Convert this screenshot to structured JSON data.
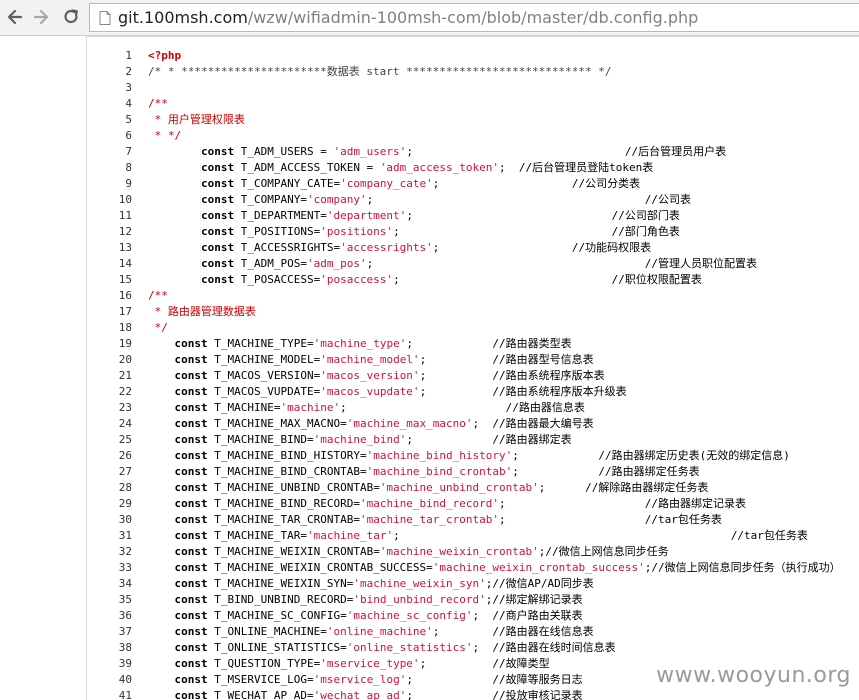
{
  "browser": {
    "url_host": "git.100msh.com",
    "url_path": "/wzw/wifiadmin-100msh-com/blob/master/db.config.php",
    "back_icon": "back-arrow-icon",
    "forward_icon": "forward-arrow-icon",
    "reload_icon": "reload-icon",
    "page_icon": "page-icon"
  },
  "code": {
    "lines": [
      {
        "n": "1",
        "segs": [
          {
            "t": "<?php",
            "k": "php"
          }
        ]
      },
      {
        "n": "2",
        "segs": [
          {
            "t": "/* * **********************数据表 start **************************** */",
            "k": "cm"
          }
        ]
      },
      {
        "n": "3",
        "segs": []
      },
      {
        "n": "4",
        "segs": [
          {
            "t": "/**",
            "k": "block"
          }
        ]
      },
      {
        "n": "5",
        "segs": [
          {
            "t": " * 用户管理权限表",
            "k": "block"
          }
        ]
      },
      {
        "n": "6",
        "segs": [
          {
            "t": " * */",
            "k": "block"
          }
        ]
      },
      {
        "n": "7",
        "segs": [
          {
            "t": "        ",
            "k": "plain"
          },
          {
            "t": "const",
            "k": "kw"
          },
          {
            "t": " T_ADM_USERS = ",
            "k": "plain"
          },
          {
            "t": "'adm_users'",
            "k": "str"
          },
          {
            "t": ";                                //后台管理员用户表",
            "k": "plain"
          }
        ]
      },
      {
        "n": "8",
        "segs": [
          {
            "t": "        ",
            "k": "plain"
          },
          {
            "t": "const",
            "k": "kw"
          },
          {
            "t": " T_ADM_ACCESS_TOKEN = ",
            "k": "plain"
          },
          {
            "t": "'adm_access_token'",
            "k": "str"
          },
          {
            "t": ";  //后台管理员登陆token表",
            "k": "plain"
          }
        ]
      },
      {
        "n": "9",
        "segs": [
          {
            "t": "        ",
            "k": "plain"
          },
          {
            "t": "const",
            "k": "kw"
          },
          {
            "t": " T_COMPANY_CATE=",
            "k": "plain"
          },
          {
            "t": "'company_cate'",
            "k": "str"
          },
          {
            "t": ";                    //公司分类表",
            "k": "plain"
          }
        ]
      },
      {
        "n": "10",
        "segs": [
          {
            "t": "        ",
            "k": "plain"
          },
          {
            "t": "const",
            "k": "kw"
          },
          {
            "t": " T_COMPANY=",
            "k": "plain"
          },
          {
            "t": "'company'",
            "k": "str"
          },
          {
            "t": ";                                         //公司表",
            "k": "plain"
          }
        ]
      },
      {
        "n": "11",
        "segs": [
          {
            "t": "        ",
            "k": "plain"
          },
          {
            "t": "const",
            "k": "kw"
          },
          {
            "t": " T_DEPARTMENT=",
            "k": "plain"
          },
          {
            "t": "'department'",
            "k": "str"
          },
          {
            "t": ";                              //公司部门表",
            "k": "plain"
          }
        ]
      },
      {
        "n": "12",
        "segs": [
          {
            "t": "        ",
            "k": "plain"
          },
          {
            "t": "const",
            "k": "kw"
          },
          {
            "t": " T_POSITIONS=",
            "k": "plain"
          },
          {
            "t": "'positions'",
            "k": "str"
          },
          {
            "t": ";                                //部门角色表",
            "k": "plain"
          }
        ]
      },
      {
        "n": "13",
        "segs": [
          {
            "t": "        ",
            "k": "plain"
          },
          {
            "t": "const",
            "k": "kw"
          },
          {
            "t": " T_ACCESSRIGHTS=",
            "k": "plain"
          },
          {
            "t": "'accessrights'",
            "k": "str"
          },
          {
            "t": ";                    //功能码权限表",
            "k": "plain"
          }
        ]
      },
      {
        "n": "14",
        "segs": [
          {
            "t": "        ",
            "k": "plain"
          },
          {
            "t": "const",
            "k": "kw"
          },
          {
            "t": " T_ADM_POS=",
            "k": "plain"
          },
          {
            "t": "'adm_pos'",
            "k": "str"
          },
          {
            "t": ";                                         //管理人员职位配置表",
            "k": "plain"
          }
        ]
      },
      {
        "n": "15",
        "segs": [
          {
            "t": "        ",
            "k": "plain"
          },
          {
            "t": "const",
            "k": "kw"
          },
          {
            "t": " T_POSACCESS=",
            "k": "plain"
          },
          {
            "t": "'posaccess'",
            "k": "str"
          },
          {
            "t": ";                                //职位权限配置表",
            "k": "plain"
          }
        ]
      },
      {
        "n": "16",
        "segs": [
          {
            "t": "/**",
            "k": "block"
          }
        ]
      },
      {
        "n": "17",
        "segs": [
          {
            "t": " * 路由器管理数据表",
            "k": "block"
          }
        ]
      },
      {
        "n": "18",
        "segs": [
          {
            "t": " */",
            "k": "block"
          }
        ]
      },
      {
        "n": "19",
        "segs": [
          {
            "t": "    ",
            "k": "plain"
          },
          {
            "t": "const",
            "k": "kw"
          },
          {
            "t": " T_MACHINE_TYPE=",
            "k": "plain"
          },
          {
            "t": "'machine_type'",
            "k": "str"
          },
          {
            "t": ";            //路由器类型表",
            "k": "plain"
          }
        ]
      },
      {
        "n": "20",
        "segs": [
          {
            "t": "    ",
            "k": "plain"
          },
          {
            "t": "const",
            "k": "kw"
          },
          {
            "t": " T_MACHINE_MODEL=",
            "k": "plain"
          },
          {
            "t": "'machine_model'",
            "k": "str"
          },
          {
            "t": ";          //路由器型号信息表",
            "k": "plain"
          }
        ]
      },
      {
        "n": "21",
        "segs": [
          {
            "t": "    ",
            "k": "plain"
          },
          {
            "t": "const",
            "k": "kw"
          },
          {
            "t": " T_MACOS_VERSION=",
            "k": "plain"
          },
          {
            "t": "'macos_version'",
            "k": "str"
          },
          {
            "t": ";          //路由系统程序版本表",
            "k": "plain"
          }
        ]
      },
      {
        "n": "22",
        "segs": [
          {
            "t": "    ",
            "k": "plain"
          },
          {
            "t": "const",
            "k": "kw"
          },
          {
            "t": " T_MACOS_VUPDATE=",
            "k": "plain"
          },
          {
            "t": "'macos_vupdate'",
            "k": "str"
          },
          {
            "t": ";          //路由系统程序版本升级表",
            "k": "plain"
          }
        ]
      },
      {
        "n": "23",
        "segs": [
          {
            "t": "    ",
            "k": "plain"
          },
          {
            "t": "const",
            "k": "kw"
          },
          {
            "t": " T_MACHINE=",
            "k": "plain"
          },
          {
            "t": "'machine'",
            "k": "str"
          },
          {
            "t": ";                        //路由器信息表",
            "k": "plain"
          }
        ]
      },
      {
        "n": "24",
        "segs": [
          {
            "t": "    ",
            "k": "plain"
          },
          {
            "t": "const",
            "k": "kw"
          },
          {
            "t": " T_MACHINE_MAX_MACNO=",
            "k": "plain"
          },
          {
            "t": "'machine_max_macno'",
            "k": "str"
          },
          {
            "t": ";  //路由器最大编号表",
            "k": "plain"
          }
        ]
      },
      {
        "n": "25",
        "segs": [
          {
            "t": "    ",
            "k": "plain"
          },
          {
            "t": "const",
            "k": "kw"
          },
          {
            "t": " T_MACHINE_BIND=",
            "k": "plain"
          },
          {
            "t": "'machine_bind'",
            "k": "str"
          },
          {
            "t": ";            //路由器绑定表",
            "k": "plain"
          }
        ]
      },
      {
        "n": "26",
        "segs": [
          {
            "t": "    ",
            "k": "plain"
          },
          {
            "t": "const",
            "k": "kw"
          },
          {
            "t": " T_MACHINE_BIND_HISTORY=",
            "k": "plain"
          },
          {
            "t": "'machine_bind_history'",
            "k": "str"
          },
          {
            "t": ";            //路由器绑定历史表(无效的绑定信息)",
            "k": "plain"
          }
        ]
      },
      {
        "n": "27",
        "segs": [
          {
            "t": "    ",
            "k": "plain"
          },
          {
            "t": "const",
            "k": "kw"
          },
          {
            "t": " T_MACHINE_BIND_CRONTAB=",
            "k": "plain"
          },
          {
            "t": "'machine_bind_crontab'",
            "k": "str"
          },
          {
            "t": ";            //路由器绑定任务表",
            "k": "plain"
          }
        ]
      },
      {
        "n": "28",
        "segs": [
          {
            "t": "    ",
            "k": "plain"
          },
          {
            "t": "const",
            "k": "kw"
          },
          {
            "t": " T_MACHINE_UNBIND_CRONTAB=",
            "k": "plain"
          },
          {
            "t": "'machine_unbind_crontab'",
            "k": "str"
          },
          {
            "t": ";      //解除路由器绑定任务表",
            "k": "plain"
          }
        ]
      },
      {
        "n": "29",
        "segs": [
          {
            "t": "    ",
            "k": "plain"
          },
          {
            "t": "const",
            "k": "kw"
          },
          {
            "t": " T_MACHINE_BIND_RECORD=",
            "k": "plain"
          },
          {
            "t": "'machine_bind_record'",
            "k": "str"
          },
          {
            "t": ";                     //路由器绑定记录表",
            "k": "plain"
          }
        ]
      },
      {
        "n": "30",
        "segs": [
          {
            "t": "    ",
            "k": "plain"
          },
          {
            "t": "const",
            "k": "kw"
          },
          {
            "t": " T_MACHINE_TAR_CRONTAB=",
            "k": "plain"
          },
          {
            "t": "'machine_tar_crontab'",
            "k": "str"
          },
          {
            "t": ";                     //tar包任务表",
            "k": "plain"
          }
        ]
      },
      {
        "n": "31",
        "segs": [
          {
            "t": "    ",
            "k": "plain"
          },
          {
            "t": "const",
            "k": "kw"
          },
          {
            "t": " T_MACHINE_TAR=",
            "k": "plain"
          },
          {
            "t": "'machine_tar'",
            "k": "str"
          },
          {
            "t": ";                                                  //tar包任务表",
            "k": "plain"
          }
        ]
      },
      {
        "n": "32",
        "segs": [
          {
            "t": "    ",
            "k": "plain"
          },
          {
            "t": "const",
            "k": "kw"
          },
          {
            "t": " T_MACHINE_WEIXIN_CRONTAB=",
            "k": "plain"
          },
          {
            "t": "'machine_weixin_crontab'",
            "k": "str"
          },
          {
            "t": ";//微信上网信息同步任务",
            "k": "plain"
          }
        ]
      },
      {
        "n": "33",
        "segs": [
          {
            "t": "    ",
            "k": "plain"
          },
          {
            "t": "const",
            "k": "kw"
          },
          {
            "t": " T_MACHINE_WEIXIN_CRONTAB_SUCCESS=",
            "k": "plain"
          },
          {
            "t": "'machine_weixin_crontab_success'",
            "k": "str"
          },
          {
            "t": ";//微信上网信息同步任务（执行成功）",
            "k": "plain"
          }
        ]
      },
      {
        "n": "34",
        "segs": [
          {
            "t": "    ",
            "k": "plain"
          },
          {
            "t": "const",
            "k": "kw"
          },
          {
            "t": " T_MACHINE_WEIXIN_SYN=",
            "k": "plain"
          },
          {
            "t": "'machine_weixin_syn'",
            "k": "str"
          },
          {
            "t": ";//微信AP/AD同步表",
            "k": "plain"
          }
        ]
      },
      {
        "n": "35",
        "segs": [
          {
            "t": "    ",
            "k": "plain"
          },
          {
            "t": "const",
            "k": "kw"
          },
          {
            "t": " T_BIND_UNBIND_RECORD=",
            "k": "plain"
          },
          {
            "t": "'bind_unbind_record'",
            "k": "str"
          },
          {
            "t": ";//绑定解绑记录表",
            "k": "plain"
          }
        ]
      },
      {
        "n": "36",
        "segs": [
          {
            "t": "    ",
            "k": "plain"
          },
          {
            "t": "const",
            "k": "kw"
          },
          {
            "t": " T_MACHINE_SC_CONFIG=",
            "k": "plain"
          },
          {
            "t": "'machine_sc_config'",
            "k": "str"
          },
          {
            "t": ";  //商户路由关联表",
            "k": "plain"
          }
        ]
      },
      {
        "n": "37",
        "segs": [
          {
            "t": "    ",
            "k": "plain"
          },
          {
            "t": "const",
            "k": "kw"
          },
          {
            "t": " T_ONLINE_MACHINE=",
            "k": "plain"
          },
          {
            "t": "'online_machine'",
            "k": "str"
          },
          {
            "t": ";        //路由器在线信息表",
            "k": "plain"
          }
        ]
      },
      {
        "n": "38",
        "segs": [
          {
            "t": "    ",
            "k": "plain"
          },
          {
            "t": "const",
            "k": "kw"
          },
          {
            "t": " T_ONLINE_STATISTICS=",
            "k": "plain"
          },
          {
            "t": "'online_statistics'",
            "k": "str"
          },
          {
            "t": ";  //路由器在线时间信息表",
            "k": "plain"
          }
        ]
      },
      {
        "n": "39",
        "segs": [
          {
            "t": "    ",
            "k": "plain"
          },
          {
            "t": "const",
            "k": "kw"
          },
          {
            "t": " T_QUESTION_TYPE=",
            "k": "plain"
          },
          {
            "t": "'mservice_type'",
            "k": "str"
          },
          {
            "t": ";          //故障类型",
            "k": "plain"
          }
        ]
      },
      {
        "n": "40",
        "segs": [
          {
            "t": "    ",
            "k": "plain"
          },
          {
            "t": "const",
            "k": "kw"
          },
          {
            "t": " T_MSERVICE_LOG=",
            "k": "plain"
          },
          {
            "t": "'mservice_log'",
            "k": "str"
          },
          {
            "t": ";            //故障等服务日志",
            "k": "plain"
          }
        ]
      },
      {
        "n": "41",
        "segs": [
          {
            "t": "    ",
            "k": "plain"
          },
          {
            "t": "const",
            "k": "kw"
          },
          {
            "t": " T_WECHAT_AP_AD=",
            "k": "plain"
          },
          {
            "t": "'wechat_ap_ad'",
            "k": "str"
          },
          {
            "t": ";            //投放审核记录表",
            "k": "plain"
          }
        ]
      }
    ]
  },
  "watermark": "www.wooyun.org"
}
